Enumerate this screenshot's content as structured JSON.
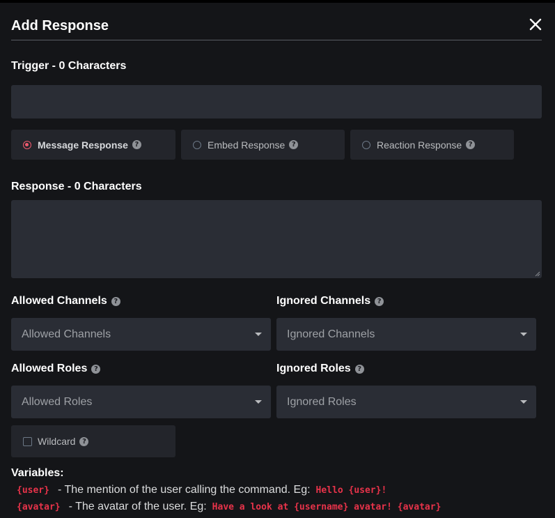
{
  "dialog": {
    "title": "Add Response"
  },
  "trigger": {
    "label": "Trigger - 0 Characters",
    "value": ""
  },
  "response_types": [
    {
      "label": "Message Response",
      "selected": true
    },
    {
      "label": "Embed Response",
      "selected": false
    },
    {
      "label": "Reaction Response",
      "selected": false
    }
  ],
  "response": {
    "label": "Response - 0 Characters",
    "value": ""
  },
  "allowed_channels": {
    "label": "Allowed Channels",
    "placeholder": "Allowed Channels"
  },
  "ignored_channels": {
    "label": "Ignored Channels",
    "placeholder": "Ignored Channels"
  },
  "allowed_roles": {
    "label": "Allowed Roles",
    "placeholder": "Allowed Roles"
  },
  "ignored_roles": {
    "label": "Ignored Roles",
    "placeholder": "Ignored Roles"
  },
  "wildcard": {
    "label": "Wildcard",
    "checked": false
  },
  "variables": {
    "heading": "Variables:",
    "items": [
      {
        "name": "{user}",
        "description": "- The mention of the user calling the command. Eg:",
        "example": "Hello {user}!"
      },
      {
        "name": "{avatar}",
        "description": "- The avatar of the user. Eg:",
        "example": "Have a look at {username} avatar! {avatar}"
      }
    ]
  },
  "colors": {
    "accent": "#f05a6e",
    "variable_code": "#e8334a",
    "modal_bg": "#141518",
    "input_bg": "#2a2d35"
  },
  "icons": {
    "close": "close-icon",
    "help": "question-circle-icon",
    "dropdown": "caret-down-icon"
  }
}
